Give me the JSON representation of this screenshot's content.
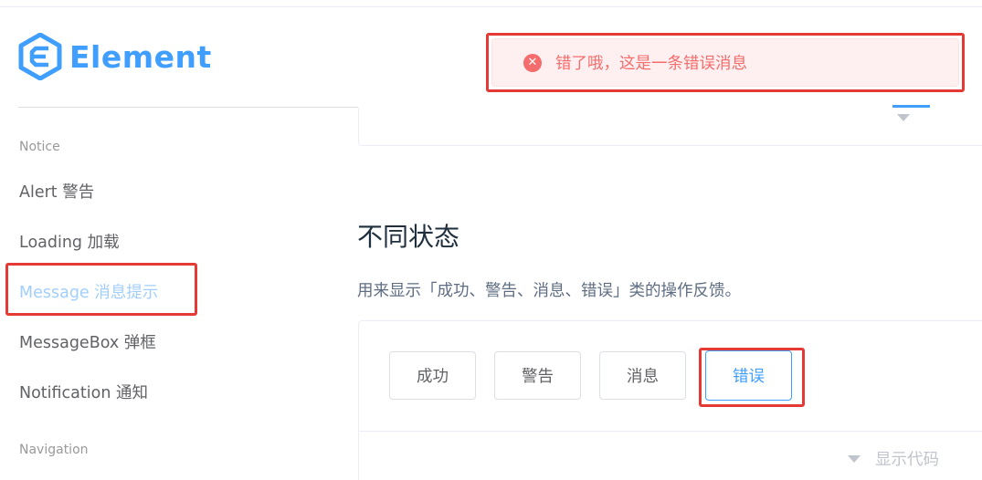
{
  "brand": {
    "name": "Element",
    "color": "#409eff"
  },
  "sidebar": {
    "groups": [
      {
        "label": "Notice"
      },
      {
        "label": "Navigation"
      }
    ],
    "items": [
      {
        "label": "Alert 警告"
      },
      {
        "label": "Loading 加载"
      },
      {
        "label": "Message 消息提示",
        "active": true
      },
      {
        "label": "MessageBox 弹框"
      },
      {
        "label": "Notification 通知"
      }
    ]
  },
  "main": {
    "section_title": "不同状态",
    "section_desc": "用来显示「成功、警告、消息、错误」类的操作反馈。",
    "buttons": [
      {
        "label": "成功"
      },
      {
        "label": "警告"
      },
      {
        "label": "消息"
      },
      {
        "label": "错误",
        "focused": true
      }
    ],
    "show_code_label": "显示代码"
  },
  "toast": {
    "type": "error",
    "icon": "error-circle-icon",
    "text": "错了哦，这是一条错误消息",
    "color": "#f56c6c",
    "background": "#fef0f0"
  },
  "colors": {
    "highlight": "#e53935",
    "text": "#606266",
    "muted": "#999999"
  }
}
